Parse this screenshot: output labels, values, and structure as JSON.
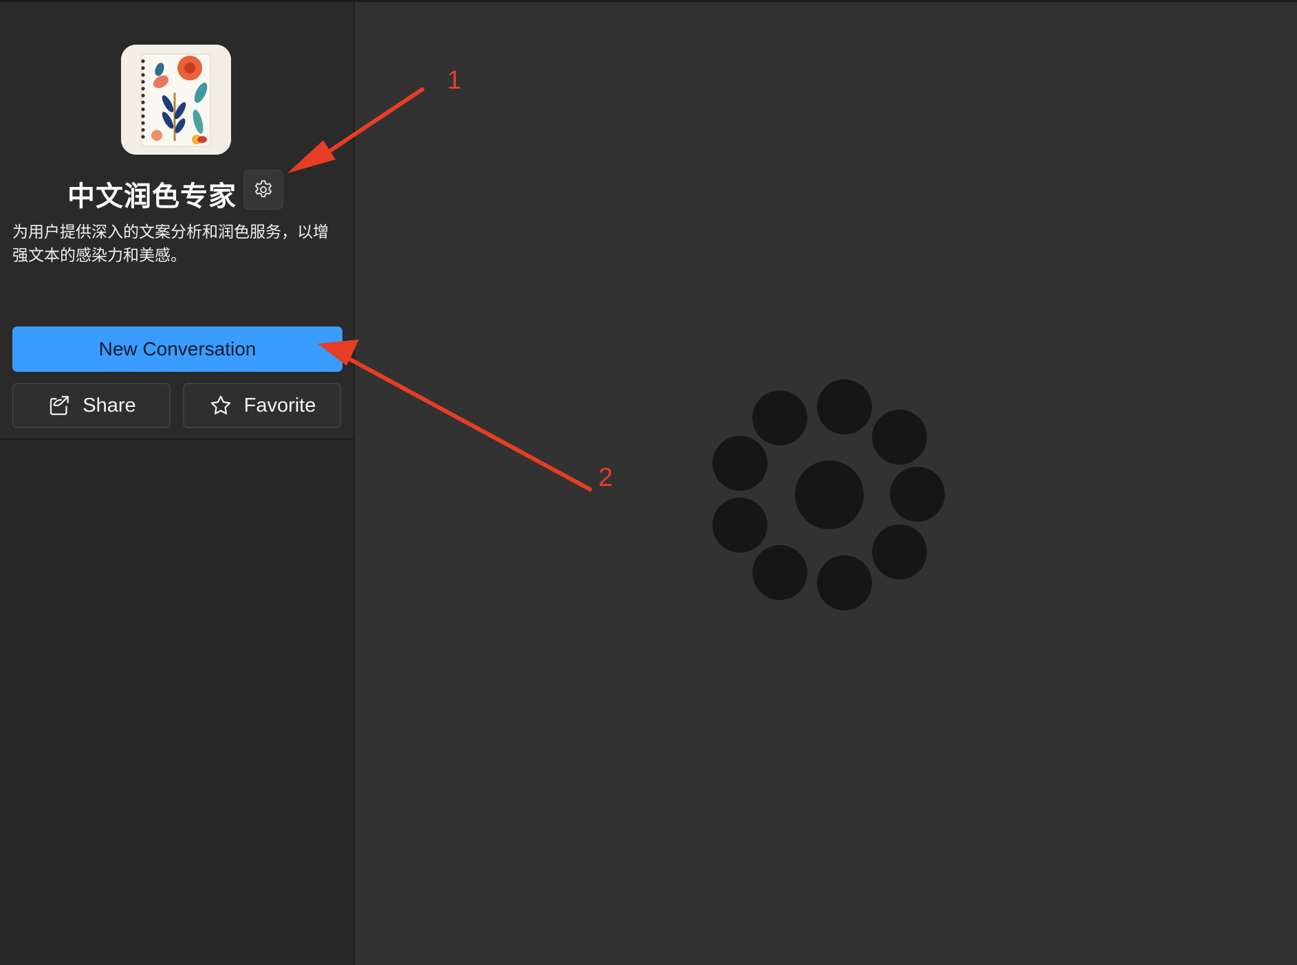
{
  "bot": {
    "title": "中文润色专家",
    "description": "为用户提供深入的文案分析和润色服务，以增强文本的感染力和美感。",
    "avatar_icon": "floral-notebook-icon"
  },
  "actions": {
    "new_conversation_label": "New Conversation",
    "share_label": "Share",
    "favorite_label": "Favorite",
    "settings_icon": "gear-icon",
    "share_icon": "share-icon",
    "favorite_icon": "star-icon"
  },
  "main": {
    "state": "loading",
    "spinner_icon": "loading-spinner-icon"
  },
  "annotations": {
    "label_1": "1",
    "label_2": "2",
    "arrow_color": "#e63d25"
  },
  "colors": {
    "accent": "#3b9cff",
    "sidebar_bg": "#2a2a2a",
    "main_bg": "#323232"
  }
}
